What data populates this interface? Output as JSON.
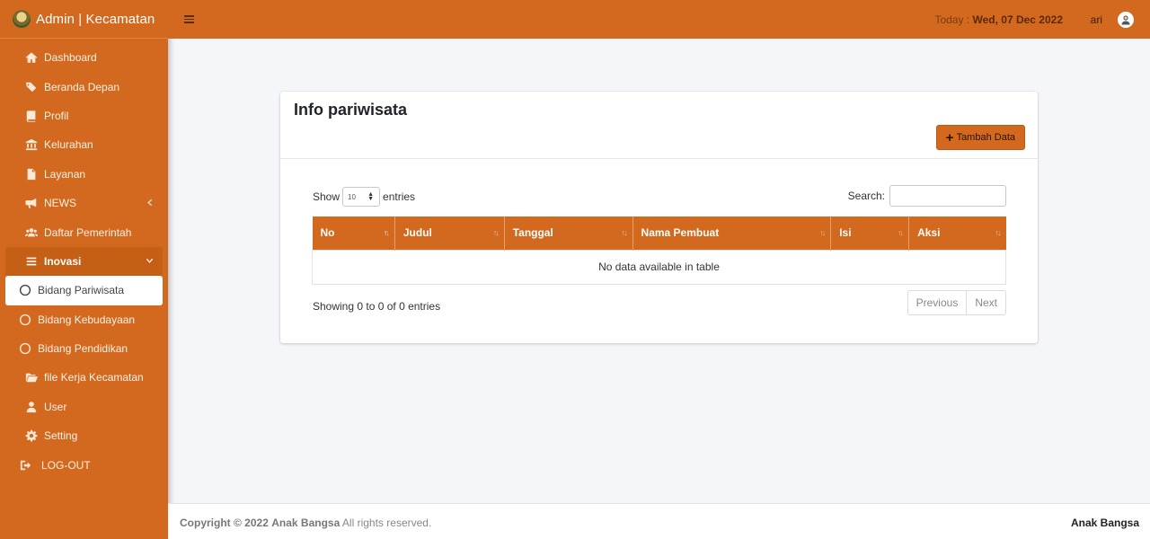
{
  "brand": {
    "title": "Admin | Kecamatan"
  },
  "sidebar": {
    "items": [
      {
        "label": "Dashboard",
        "icon": "home-icon"
      },
      {
        "label": "Beranda Depan",
        "icon": "tags-icon"
      },
      {
        "label": "Profil",
        "icon": "book-icon"
      },
      {
        "label": "Kelurahan",
        "icon": "landmark-icon"
      },
      {
        "label": "Layanan",
        "icon": "file-icon"
      },
      {
        "label": "NEWS",
        "icon": "megaphone-icon"
      },
      {
        "label": "Daftar Pemerintah",
        "icon": "users-icon"
      },
      {
        "label": "Inovasi",
        "icon": "list-icon"
      },
      {
        "label": "Bidang Pariwisata",
        "icon": "circle-icon"
      },
      {
        "label": "Bidang Kebudayaan",
        "icon": "circle-icon"
      },
      {
        "label": "Bidang Pendidikan",
        "icon": "circle-icon"
      },
      {
        "label": "file Kerja Kecamatan",
        "icon": "folder-open-icon"
      },
      {
        "label": "User",
        "icon": "user-icon"
      },
      {
        "label": "Setting",
        "icon": "gear-icon"
      },
      {
        "label": "LOG-OUT",
        "icon": "sign-out-icon"
      }
    ]
  },
  "topbar": {
    "today_label": "Today : ",
    "today_date": "Wed, 07 Dec 2022",
    "username": "ari"
  },
  "card": {
    "title": "Info pariwisata",
    "add_button": "Tambah Data",
    "show_label": "Show",
    "entries_label": "entries",
    "length_value": "10",
    "search_label": "Search:",
    "columns": [
      "No",
      "Judul",
      "Tanggal",
      "Nama Pembuat",
      "Isi",
      "Aksi"
    ],
    "empty_text": "No data available in table",
    "info_text": "Showing 0 to 0 of 0 entries",
    "prev_label": "Previous",
    "next_label": "Next"
  },
  "footer": {
    "copyright": "Copyright © 2022",
    "company": "Anak Bangsa",
    "rights": " All rights reserved.",
    "brand_right": "Anak Bangsa"
  },
  "colors": {
    "primary": "#d2691e",
    "background": "#f4f6f9"
  }
}
